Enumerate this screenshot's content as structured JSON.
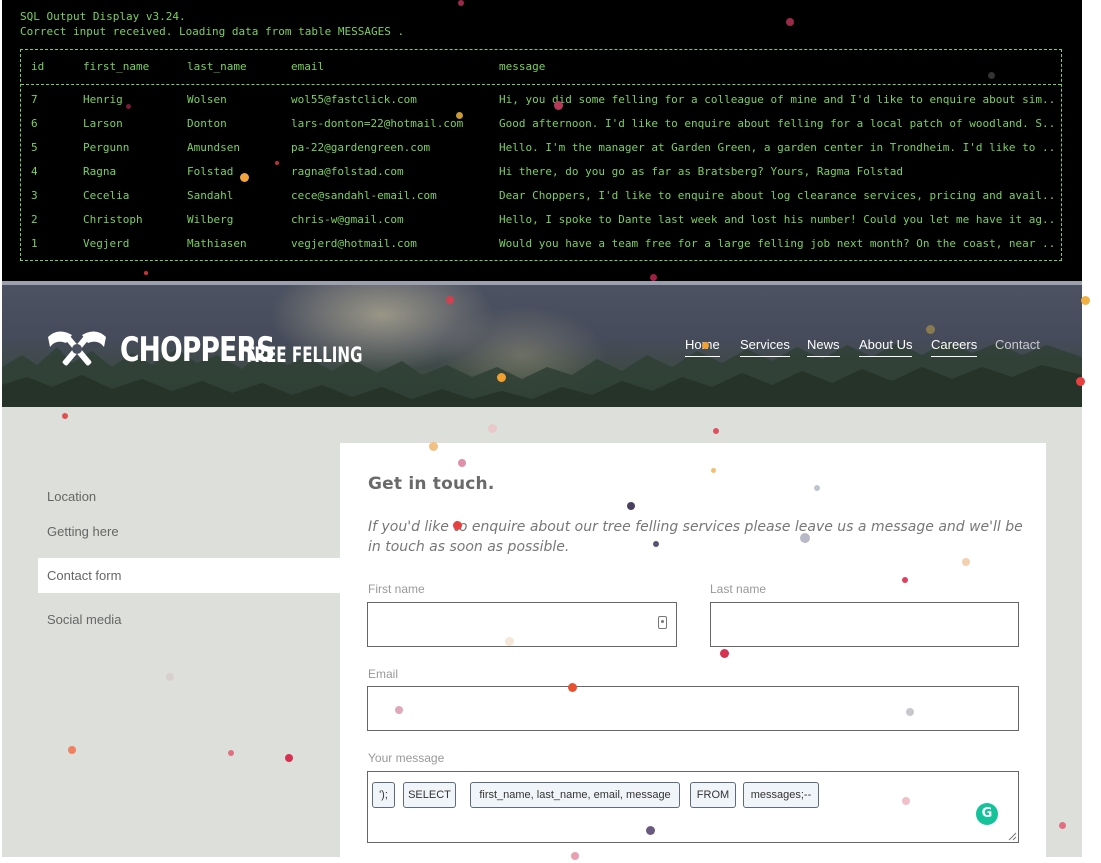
{
  "terminal": {
    "title": "SQL Output Display v3.24.",
    "status": "Correct input received. Loading data from table MESSAGES .",
    "columns": [
      "id",
      "first_name",
      "last_name",
      "email",
      "message"
    ],
    "rows": [
      {
        "id": "7",
        "first_name": "Henrig",
        "last_name": "Wolsen",
        "email": "wol55@fastclick.com",
        "message": "Hi, you did some felling for a colleague of mine and I'd like to enquire about sim..."
      },
      {
        "id": "6",
        "first_name": "Larson",
        "last_name": "Donton",
        "email": "lars-donton=22@hotmail.com",
        "message": "Good afternoon. I'd like to enquire about felling for a local patch of woodland. S..."
      },
      {
        "id": "5",
        "first_name": "Pergunn",
        "last_name": "Amundsen",
        "email": "pa-22@gardengreen.com",
        "message": "Hello. I'm the manager at Garden Green, a garden center in Trondheim. I'd like to ..."
      },
      {
        "id": "4",
        "first_name": "Ragna",
        "last_name": "Folstad",
        "email": "ragna@folstad.com",
        "message": "Hi there, do you go as far as Bratsberg? Yours, Ragma Folstad"
      },
      {
        "id": "3",
        "first_name": "Cecelia",
        "last_name": "Sandahl",
        "email": "cece@sandahl-email.com",
        "message": "Dear Choppers, I'd like to enquire about log clearance services, pricing and avail..."
      },
      {
        "id": "2",
        "first_name": "Christoph",
        "last_name": "Wilberg",
        "email": "chris-w@gmail.com",
        "message": "Hello, I spoke to Dante last week and lost his number! Could you let me have it ag..."
      },
      {
        "id": "1",
        "first_name": "Vegjerd",
        "last_name": "Mathiasen",
        "email": "vegjerd@hotmail.com",
        "message": "Would you have a team free for a large felling job next month? On the coast, near ..."
      }
    ]
  },
  "header": {
    "logo_main": "CHOPPERS",
    "logo_sub": "TREE FELLING",
    "nav": [
      {
        "label": "Home",
        "active": true
      },
      {
        "label": "Services",
        "active": true
      },
      {
        "label": "News",
        "active": true
      },
      {
        "label": "About Us",
        "active": true
      },
      {
        "label": "Careers",
        "active": true
      },
      {
        "label": "Contact",
        "active": false
      }
    ]
  },
  "sidebar": {
    "items": [
      {
        "label": "Location"
      },
      {
        "label": "Getting here"
      },
      {
        "label": "Contact form",
        "selected": true
      },
      {
        "label": "Social media"
      }
    ]
  },
  "form": {
    "title": "Get in touch.",
    "intro": "If you'd like to enquire about our tree felling services please leave us a message and we'll be in touch as soon as possible.",
    "first_name_label": "First name",
    "first_name_value": "",
    "last_name_label": "Last name",
    "last_name_value": "",
    "email_label": "Email",
    "email_value": "",
    "message_label": "Your message",
    "message_tokens": [
      "');",
      "SELECT",
      "first_name, last_name, email, message",
      "FROM",
      "messages;--"
    ],
    "grammarly_letter": "G"
  },
  "colors": {
    "terminal_text": "#7bd05d",
    "terminal_bg": "#000000",
    "content_bg": "#dddfdb",
    "grammarly": "#15c39a"
  }
}
